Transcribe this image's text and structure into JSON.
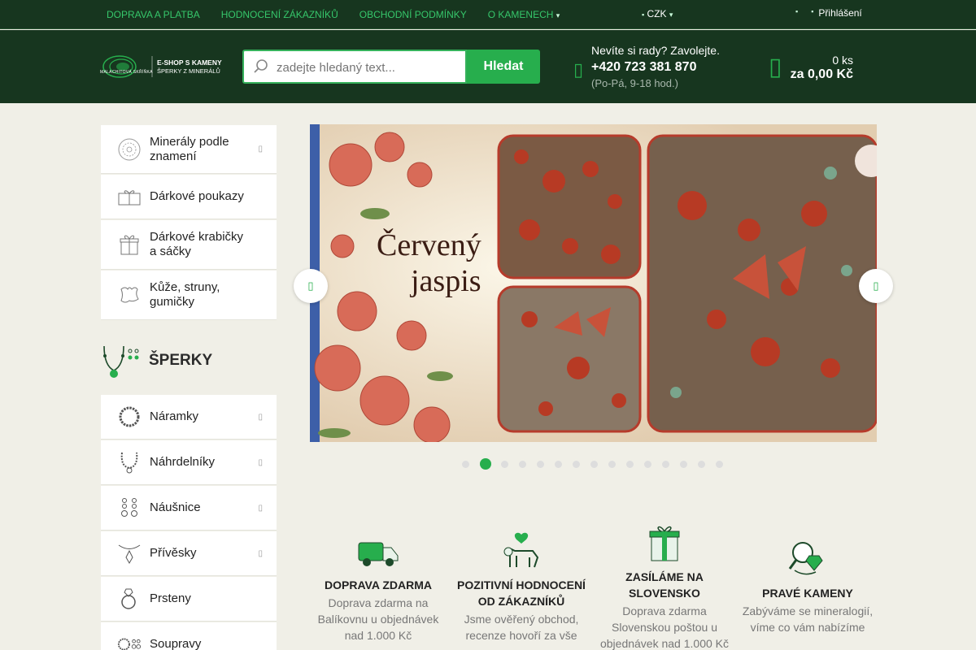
{
  "topbar": {
    "links": [
      "DOPRAVA A PLATBA",
      "HODNOCENÍ ZÁKAZNÍKŮ",
      "OBCHODNÍ PODMÍNKY",
      "O KAMENECH"
    ],
    "currency": "CZK",
    "login": "Přihlášení"
  },
  "header": {
    "logo_name": "MALACHITOVÁ SKŘÍŇKA",
    "logo_line1": "E-SHOP S KAMENY",
    "logo_line2": "ŠPERKY Z MINERÁLŮ",
    "search_placeholder": "zadejte hledaný text...",
    "search_button": "Hledat",
    "contact_line1": "Nevíte si rady? Zavolejte.",
    "contact_phone": "+420 723 381 870",
    "contact_hours": "(Po-Pá, 9-18 hod.)",
    "cart_count": "0 ks",
    "cart_total": "za 0,00 Kč"
  },
  "sidebar": {
    "top_items": [
      {
        "label": "Minerály podle znamení",
        "icon": "zodiac-icon",
        "has_submenu": true
      },
      {
        "label": "Dárkové poukazy",
        "icon": "gift-voucher-icon",
        "has_submenu": false
      },
      {
        "label": "Dárkové krabičky a sáčky",
        "icon": "gift-box-icon",
        "has_submenu": false
      },
      {
        "label": "Kůže, struny, gumičky",
        "icon": "leather-icon",
        "has_submenu": false
      }
    ],
    "section_title": "ŠPERKY",
    "jewelry_items": [
      {
        "label": "Náramky",
        "icon": "bracelet-icon",
        "has_submenu": true
      },
      {
        "label": "Náhrdelníky",
        "icon": "necklace-icon",
        "has_submenu": true
      },
      {
        "label": "Náušnice",
        "icon": "earrings-icon",
        "has_submenu": true
      },
      {
        "label": "Přívěsky",
        "icon": "pendant-icon",
        "has_submenu": true
      },
      {
        "label": "Prsteny",
        "icon": "ring-icon",
        "has_submenu": false
      },
      {
        "label": "Soupravy",
        "icon": "jewelry-set-icon",
        "has_submenu": false
      }
    ]
  },
  "carousel": {
    "slide_title_line1": "Červený",
    "slide_title_line2": "jaspis",
    "dot_count": 15,
    "active_index": 1
  },
  "features": [
    {
      "title": "DOPRAVA ZDARMA",
      "text": "Doprava zdarma na Balíkovnu u objednávek nad 1.000 Kč",
      "icon": "delivery-van-icon"
    },
    {
      "title": "POZITIVNÍ HODNOCENÍ OD ZÁKAZNÍKŮ",
      "text": "Jsme ověřený obchod, recenze hovoří za vše",
      "icon": "happy-dog-icon"
    },
    {
      "title": "ZASÍLÁME NA SLOVENSKO",
      "text": "Doprava zdarma Slovenskou poštou u objednávek nad 1.000 Kč",
      "icon": "gift-icon"
    },
    {
      "title": "PRAVÉ KAMENY",
      "text": "Zabýváme se mineralogií, víme co vám nabízíme",
      "icon": "magnifier-gem-icon"
    }
  ],
  "colors": {
    "brand_dark": "#17361f",
    "accent_green": "#27ae4d",
    "background": "#f0efe7"
  }
}
